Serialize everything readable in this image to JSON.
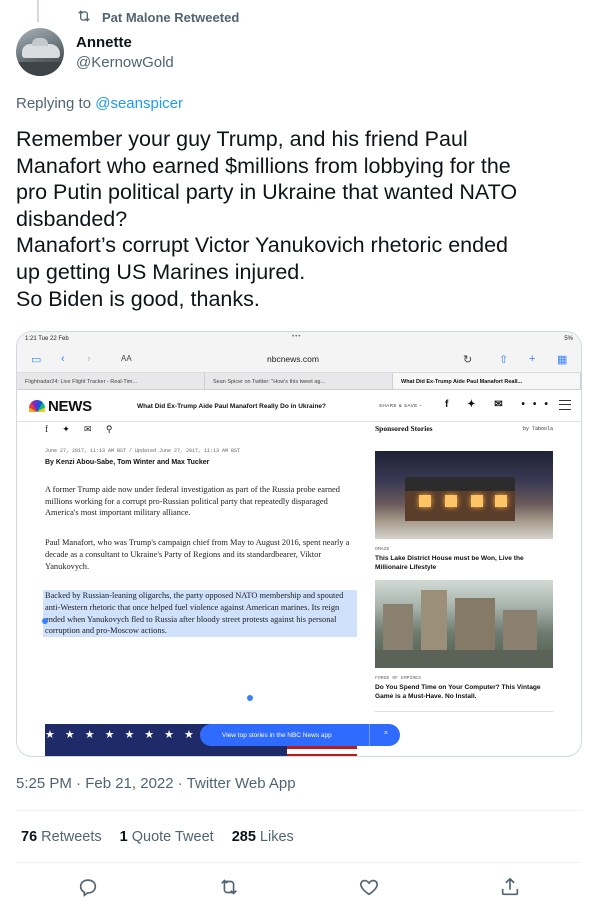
{
  "retweeted_by": "Pat Malone Retweeted",
  "author": {
    "name": "Annette",
    "handle": "@KernowGold"
  },
  "replying": {
    "prefix": "Replying to ",
    "handle": "@seanspicer"
  },
  "tweet_lines": [
    "Remember your guy Trump, and his friend Paul",
    "Manafort who earned $millions from lobbying for the",
    "pro Putin political party in Ukraine that wanted NATO",
    "disbanded?",
    "Manafort’s corrupt Victor Yanukovich rhetoric ended",
    "up getting US Marines injured.",
    "So Biden is good, thanks."
  ],
  "embed": {
    "status_time": "1:21  Tue 22 Feb",
    "status_dots": "•••",
    "battery": "5%",
    "text_size_label": "AA",
    "url": "nbcnews.com",
    "tabs": [
      "Flightradar24: Live Flight Tracker - Real-Tim...",
      "Sean Spicer on Twitter: \"How's this tweet ag...",
      "What Did Ex-Trump Aide Paul Manafort Reall..."
    ],
    "site_name": "NEWS",
    "headline": "What Did Ex-Trump Aide Paul Manafort Really Do in Ukraine?",
    "share_label": "SHARE & SAVE –",
    "date_line": "June 27, 2017, 11:13 AM BST / Updated June 27, 2017, 11:13 AM BST",
    "byline": "By Kenzi Abou-Sabe, Tom Winter and Max Tucker",
    "paragraphs": [
      "A former Trump aide now under federal investigation as part of the Russia probe earned millions working for a corrupt pro-Russian political party that repeatedly disparaged America's most important military alliance.",
      "Paul Manafort, who was Trump's campaign chief from May to August 2016, spent nearly a decade as a consultant to Ukraine's Party of Regions and its standardbearer, Viktor Yanukovych.",
      "Backed by Russian-leaning oligarchs, the party opposed NATO membership and spouted anti-Western rhetoric that once helped fuel violence against American marines. Its reign ended when Yanukovych fled to Russia after bloody street protests against his personal corruption and pro-Moscow actions."
    ],
    "sponsored_title": "Sponsored Stories",
    "sponsored_by": "by Taboola",
    "cards": [
      {
        "source": "OMAZE",
        "title": "This Lake District House must be Won, Live the Millionaire Lifestyle"
      },
      {
        "source": "FORGE OF EMPIRES",
        "title": "Do You Spend Time on Your Computer? This Vintage Game is a Must-Have. No Install."
      }
    ],
    "pill_text": "View top stories in the NBC News app",
    "pill_close": "×"
  },
  "timestamp": "5:25 PM · Feb 21, 2022 · Twitter Web App",
  "stats": {
    "retweets_count": "76",
    "retweets_label": "Retweets",
    "quotes_count": "1",
    "quotes_label": "Quote Tweet",
    "likes_count": "285",
    "likes_label": "Likes"
  }
}
